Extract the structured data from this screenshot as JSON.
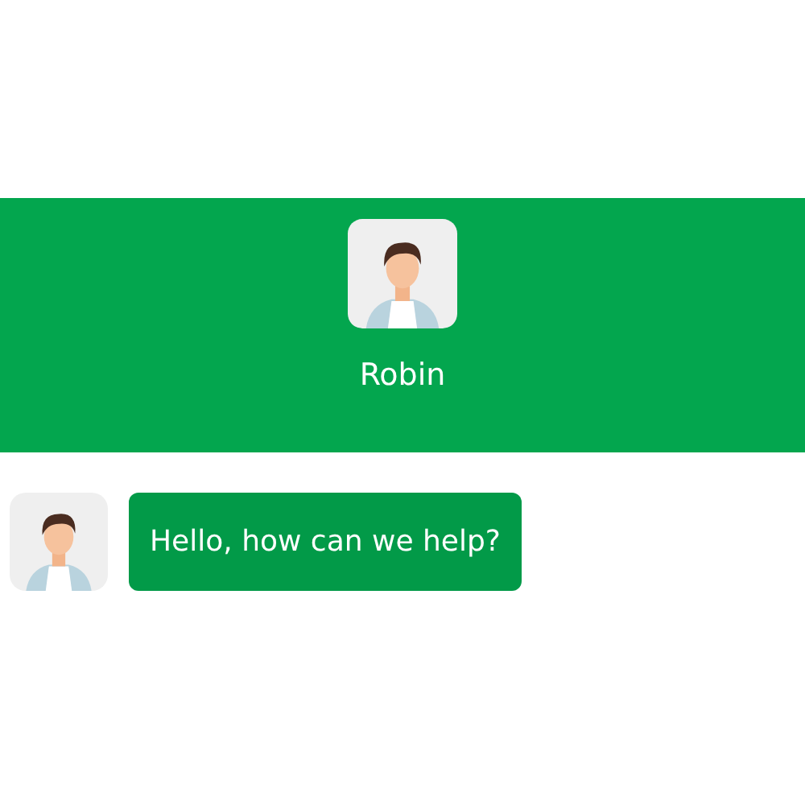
{
  "header": {
    "agent_name": "Robin"
  },
  "messages": [
    {
      "kind": "agent",
      "text": "Hello, how can we help?"
    }
  ]
}
